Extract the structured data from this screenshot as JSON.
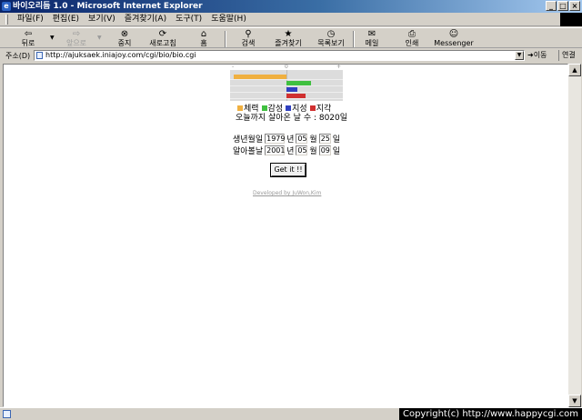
{
  "window": {
    "title": "바이오리듬 1.0 - Microsoft Internet Explorer",
    "buttons": [
      "_",
      "□",
      "×"
    ]
  },
  "menu": [
    "파일(F)",
    "편집(E)",
    "보기(V)",
    "즐겨찾기(A)",
    "도구(T)",
    "도움말(H)"
  ],
  "toolbar": {
    "back": "뒤로",
    "forward": "앞으로",
    "stop": "중지",
    "refresh": "새로고침",
    "home": "홈",
    "search": "검색",
    "favorites": "즐겨찾기",
    "history": "목록보기",
    "mail": "메일",
    "print": "인쇄",
    "messenger": "Messenger"
  },
  "address": {
    "label": "주소(D)",
    "url": "http://ajuksaek.iniajoy.com/cgi/bio/bio.cgi",
    "go": "이동",
    "links": "연결"
  },
  "chart_data": {
    "type": "bar",
    "scale_labels": [
      "-",
      "0",
      "+"
    ],
    "xlim": [
      -100,
      100
    ],
    "series": [
      {
        "name": "체력",
        "color": "#f0b040",
        "value": -95
      },
      {
        "name": "감성",
        "color": "#40c040",
        "value": 45
      },
      {
        "name": "지성",
        "color": "#3040c0",
        "value": 20
      },
      {
        "name": "지각",
        "color": "#d03030",
        "value": 35
      }
    ]
  },
  "days_lived": "오늘까지 살아온 날 수 : 8020일",
  "birth": {
    "label": "생년월일",
    "year": "1979",
    "month": "05",
    "day": "25"
  },
  "target": {
    "label": "알아볼날",
    "year": "2001",
    "month": "05",
    "day": "09"
  },
  "units": {
    "year": "년",
    "month": "월",
    "day": "일"
  },
  "submit": "Get it !!",
  "credit": "Developed by JuWon,Kim",
  "copyright": "Copyright(c) http://www.happycgi.com"
}
